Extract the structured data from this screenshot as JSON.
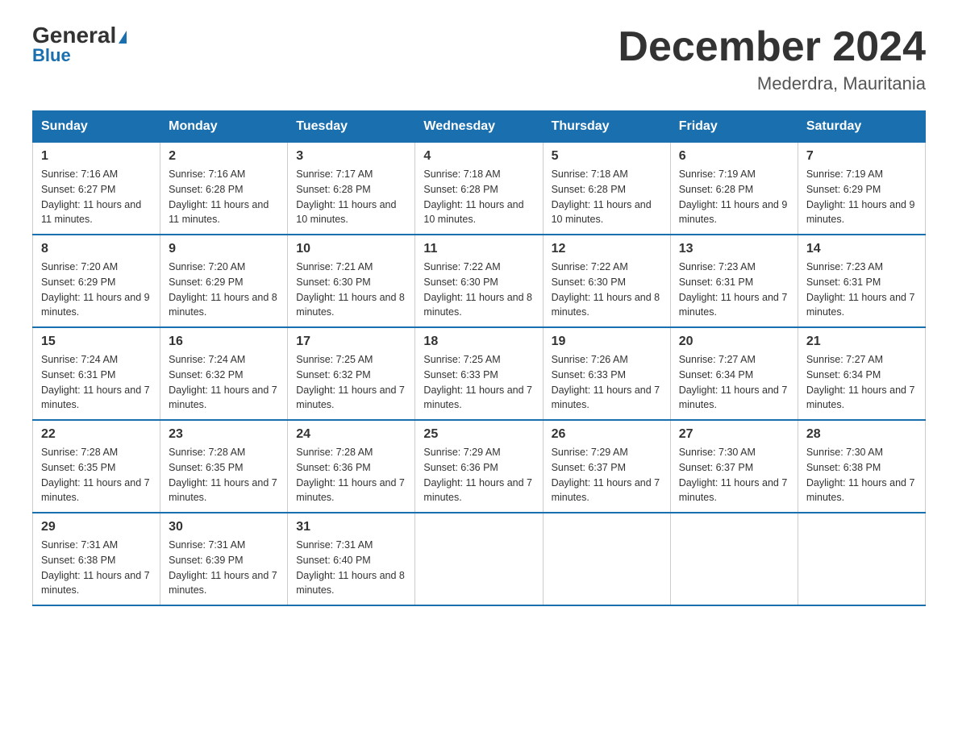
{
  "header": {
    "logo_line1": "General",
    "logo_line2": "Blue",
    "month_title": "December 2024",
    "location": "Mederdra, Mauritania"
  },
  "days_of_week": [
    "Sunday",
    "Monday",
    "Tuesday",
    "Wednesday",
    "Thursday",
    "Friday",
    "Saturday"
  ],
  "weeks": [
    [
      {
        "day": "1",
        "sunrise": "7:16 AM",
        "sunset": "6:27 PM",
        "daylight": "11 hours and 11 minutes."
      },
      {
        "day": "2",
        "sunrise": "7:16 AM",
        "sunset": "6:28 PM",
        "daylight": "11 hours and 11 minutes."
      },
      {
        "day": "3",
        "sunrise": "7:17 AM",
        "sunset": "6:28 PM",
        "daylight": "11 hours and 10 minutes."
      },
      {
        "day": "4",
        "sunrise": "7:18 AM",
        "sunset": "6:28 PM",
        "daylight": "11 hours and 10 minutes."
      },
      {
        "day": "5",
        "sunrise": "7:18 AM",
        "sunset": "6:28 PM",
        "daylight": "11 hours and 10 minutes."
      },
      {
        "day": "6",
        "sunrise": "7:19 AM",
        "sunset": "6:28 PM",
        "daylight": "11 hours and 9 minutes."
      },
      {
        "day": "7",
        "sunrise": "7:19 AM",
        "sunset": "6:29 PM",
        "daylight": "11 hours and 9 minutes."
      }
    ],
    [
      {
        "day": "8",
        "sunrise": "7:20 AM",
        "sunset": "6:29 PM",
        "daylight": "11 hours and 9 minutes."
      },
      {
        "day": "9",
        "sunrise": "7:20 AM",
        "sunset": "6:29 PM",
        "daylight": "11 hours and 8 minutes."
      },
      {
        "day": "10",
        "sunrise": "7:21 AM",
        "sunset": "6:30 PM",
        "daylight": "11 hours and 8 minutes."
      },
      {
        "day": "11",
        "sunrise": "7:22 AM",
        "sunset": "6:30 PM",
        "daylight": "11 hours and 8 minutes."
      },
      {
        "day": "12",
        "sunrise": "7:22 AM",
        "sunset": "6:30 PM",
        "daylight": "11 hours and 8 minutes."
      },
      {
        "day": "13",
        "sunrise": "7:23 AM",
        "sunset": "6:31 PM",
        "daylight": "11 hours and 7 minutes."
      },
      {
        "day": "14",
        "sunrise": "7:23 AM",
        "sunset": "6:31 PM",
        "daylight": "11 hours and 7 minutes."
      }
    ],
    [
      {
        "day": "15",
        "sunrise": "7:24 AM",
        "sunset": "6:31 PM",
        "daylight": "11 hours and 7 minutes."
      },
      {
        "day": "16",
        "sunrise": "7:24 AM",
        "sunset": "6:32 PM",
        "daylight": "11 hours and 7 minutes."
      },
      {
        "day": "17",
        "sunrise": "7:25 AM",
        "sunset": "6:32 PM",
        "daylight": "11 hours and 7 minutes."
      },
      {
        "day": "18",
        "sunrise": "7:25 AM",
        "sunset": "6:33 PM",
        "daylight": "11 hours and 7 minutes."
      },
      {
        "day": "19",
        "sunrise": "7:26 AM",
        "sunset": "6:33 PM",
        "daylight": "11 hours and 7 minutes."
      },
      {
        "day": "20",
        "sunrise": "7:27 AM",
        "sunset": "6:34 PM",
        "daylight": "11 hours and 7 minutes."
      },
      {
        "day": "21",
        "sunrise": "7:27 AM",
        "sunset": "6:34 PM",
        "daylight": "11 hours and 7 minutes."
      }
    ],
    [
      {
        "day": "22",
        "sunrise": "7:28 AM",
        "sunset": "6:35 PM",
        "daylight": "11 hours and 7 minutes."
      },
      {
        "day": "23",
        "sunrise": "7:28 AM",
        "sunset": "6:35 PM",
        "daylight": "11 hours and 7 minutes."
      },
      {
        "day": "24",
        "sunrise": "7:28 AM",
        "sunset": "6:36 PM",
        "daylight": "11 hours and 7 minutes."
      },
      {
        "day": "25",
        "sunrise": "7:29 AM",
        "sunset": "6:36 PM",
        "daylight": "11 hours and 7 minutes."
      },
      {
        "day": "26",
        "sunrise": "7:29 AM",
        "sunset": "6:37 PM",
        "daylight": "11 hours and 7 minutes."
      },
      {
        "day": "27",
        "sunrise": "7:30 AM",
        "sunset": "6:37 PM",
        "daylight": "11 hours and 7 minutes."
      },
      {
        "day": "28",
        "sunrise": "7:30 AM",
        "sunset": "6:38 PM",
        "daylight": "11 hours and 7 minutes."
      }
    ],
    [
      {
        "day": "29",
        "sunrise": "7:31 AM",
        "sunset": "6:38 PM",
        "daylight": "11 hours and 7 minutes."
      },
      {
        "day": "30",
        "sunrise": "7:31 AM",
        "sunset": "6:39 PM",
        "daylight": "11 hours and 7 minutes."
      },
      {
        "day": "31",
        "sunrise": "7:31 AM",
        "sunset": "6:40 PM",
        "daylight": "11 hours and 8 minutes."
      },
      {
        "day": "",
        "sunrise": "",
        "sunset": "",
        "daylight": ""
      },
      {
        "day": "",
        "sunrise": "",
        "sunset": "",
        "daylight": ""
      },
      {
        "day": "",
        "sunrise": "",
        "sunset": "",
        "daylight": ""
      },
      {
        "day": "",
        "sunrise": "",
        "sunset": "",
        "daylight": ""
      }
    ]
  ]
}
